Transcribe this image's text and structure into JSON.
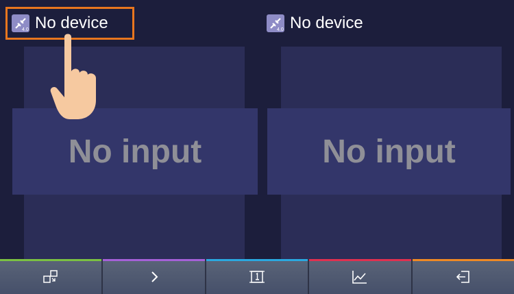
{
  "channels": [
    {
      "device_label": "No device",
      "status": "No input"
    },
    {
      "device_label": "No device",
      "status": "No input"
    }
  ],
  "icons": {
    "device": "unlinked-device-icon",
    "pointer": "hand-pointer-icon"
  },
  "toolbar": [
    {
      "icon": "switch-layout-icon",
      "color": "#7bc142"
    },
    {
      "icon": "chevron-right-icon",
      "color": "#a560d8"
    },
    {
      "icon": "capture-frame-icon",
      "color": "#2aa8e0"
    },
    {
      "icon": "line-chart-icon",
      "color": "#e03050"
    },
    {
      "icon": "exit-icon",
      "color": "#f08a24"
    }
  ],
  "colors": {
    "highlight": "#e8761e",
    "background": "#1c1e3c",
    "panel": "#2b2d57",
    "text_dim": "#8f8f97"
  }
}
